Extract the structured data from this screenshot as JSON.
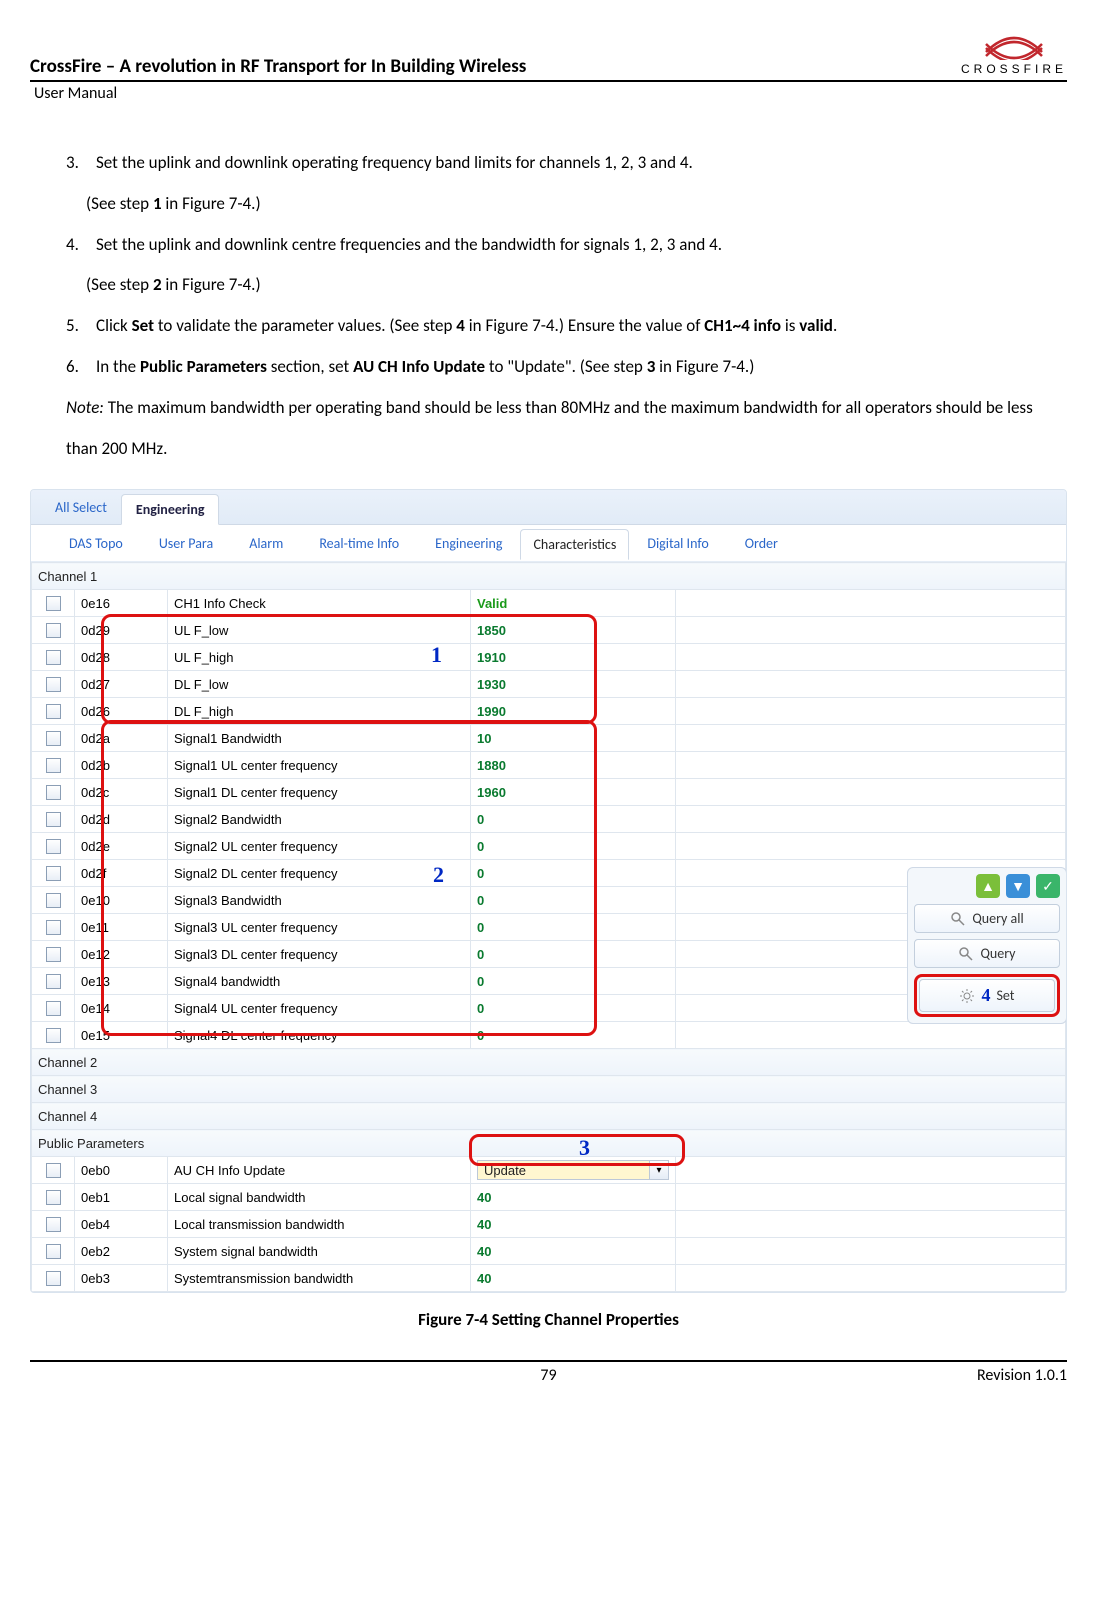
{
  "header": {
    "title": "CrossFire – A revolution in RF Transport for In Building Wireless",
    "subtitle": "User Manual",
    "logo_text": "CROSSFIRE"
  },
  "steps": {
    "s3_num": "3.",
    "s3_text": "Set the uplink and downlink operating frequency band limits for channels 1, 2, 3 and 4.",
    "s3_sub_a": "(See step ",
    "s3_sub_b": "1",
    "s3_sub_c": " in Figure 7-4.)",
    "s4_num": "4.",
    "s4_text": "Set the uplink and downlink centre frequencies and the bandwidth for signals 1, 2, 3 and 4.",
    "s4_sub_a": "(See step ",
    "s4_sub_b": "2",
    "s4_sub_c": " in Figure 7-4.)",
    "s5_num": "5.",
    "s5_a": "Click ",
    "s5_b": "Set",
    "s5_c": " to validate the parameter values. (See step ",
    "s5_d": "4",
    "s5_e": " in Figure 7-4.) Ensure the value of ",
    "s5_f": "CH1~4 info",
    "s5_g": " is ",
    "s5_h": "valid",
    "s5_i": ".",
    "s6_num": "6.",
    "s6_a": "In the ",
    "s6_b": "Public Parameters",
    "s6_c": " section, set ",
    "s6_d": "AU CH Info Update",
    "s6_e": " to \"Update\". (See step ",
    "s6_f": "3",
    "s6_g": " in Figure 7-4.)",
    "note_label": "Note:",
    "note_text": " The maximum bandwidth per operating band should be less than 80MHz and the maximum bandwidth for all operators should be less than 200 MHz."
  },
  "figure": {
    "tab_all": "All Select",
    "tab_eng": "Engineering",
    "subtabs": [
      "DAS Topo",
      "User Para",
      "Alarm",
      "Real-time Info",
      "Engineering",
      "Characteristics",
      "Digital Info",
      "Order"
    ],
    "sections": {
      "ch1": "Channel 1",
      "ch2": "Channel 2",
      "ch3": "Channel 3",
      "ch4": "Channel 4",
      "pub": "Public Parameters"
    },
    "ch1_rows": [
      {
        "code": "0e16",
        "desc": "CH1 Info Check",
        "val": "Valid",
        "valid": true
      },
      {
        "code": "0d29",
        "desc": "UL F_low",
        "val": "1850"
      },
      {
        "code": "0d28",
        "desc": "UL F_high",
        "val": "1910"
      },
      {
        "code": "0d27",
        "desc": "DL F_low",
        "val": "1930"
      },
      {
        "code": "0d26",
        "desc": "DL F_high",
        "val": "1990"
      },
      {
        "code": "0d2a",
        "desc": "Signal1 Bandwidth",
        "val": "10"
      },
      {
        "code": "0d2b",
        "desc": "Signal1 UL center frequency",
        "val": "1880"
      },
      {
        "code": "0d2c",
        "desc": "Signal1 DL center frequency",
        "val": "1960"
      },
      {
        "code": "0d2d",
        "desc": "Signal2 Bandwidth",
        "val": "0"
      },
      {
        "code": "0d2e",
        "desc": "Signal2 UL center frequency",
        "val": "0"
      },
      {
        "code": "0d2f",
        "desc": "Signal2 DL center frequency",
        "val": "0"
      },
      {
        "code": "0e10",
        "desc": "Signal3 Bandwidth",
        "val": "0"
      },
      {
        "code": "0e11",
        "desc": "Signal3 UL center frequency",
        "val": "0"
      },
      {
        "code": "0e12",
        "desc": "Signal3 DL center frequency",
        "val": "0"
      },
      {
        "code": "0e13",
        "desc": "Signal4 bandwidth",
        "val": "0"
      },
      {
        "code": "0e14",
        "desc": "Signal4 UL center frequency",
        "val": "0"
      },
      {
        "code": "0e15",
        "desc": "Signal4 DL center frequency",
        "val": "0"
      }
    ],
    "pub_rows": [
      {
        "code": "0eb0",
        "desc": "AU CH Info Update",
        "val": "Update",
        "dropdown": true
      },
      {
        "code": "0eb1",
        "desc": "Local signal bandwidth",
        "val": "40"
      },
      {
        "code": "0eb4",
        "desc": "Local transmission bandwidth",
        "val": "40"
      },
      {
        "code": "0eb2",
        "desc": "System signal bandwidth",
        "val": "40"
      },
      {
        "code": "0eb3",
        "desc": "Systemtransmission bandwidth",
        "val": "40"
      }
    ],
    "callouts": {
      "c1": "1",
      "c2": "2",
      "c3": "3",
      "c4": "4"
    },
    "side": {
      "query_all": "Query all",
      "query": "Query",
      "set": "Set"
    },
    "caption": "Figure 7-4 Setting Channel Properties"
  },
  "footer": {
    "page": "79",
    "rev": "Revision 1.0.1"
  }
}
